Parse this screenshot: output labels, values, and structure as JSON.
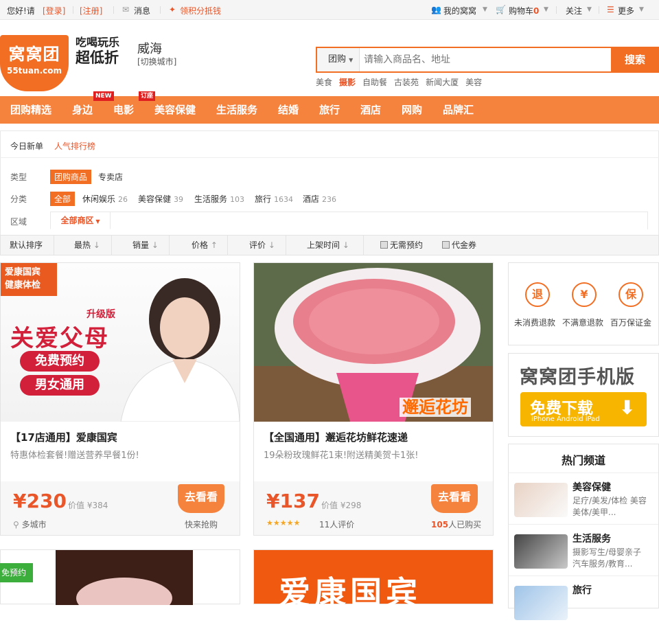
{
  "topbar": {
    "greeting": "您好!请",
    "login": "[登录]",
    "register": "[注册]",
    "messages": "消息",
    "points": "领积分抵钱",
    "my_account": "我的窝窝",
    "cart": "购物车",
    "cart_count": "0",
    "follow": "关注",
    "more": "更多"
  },
  "header": {
    "logo_main": "窝窝团",
    "logo_url": "55tuan.com",
    "slogan_line1": "吃喝玩乐",
    "slogan_line2": "超低折",
    "city": "威海",
    "city_switch": "[切换城市]",
    "search_type": "团购",
    "search_placeholder": "请输入商品名、地址",
    "search_button": "搜索",
    "hot_words": [
      "美食",
      "摄影",
      "自助餐",
      "古装苑",
      "新闻大厦",
      "美容"
    ]
  },
  "nav": {
    "items": [
      "团购精选",
      "身边",
      "电影",
      "美容保健",
      "生活服务",
      "结婚",
      "旅行",
      "酒店",
      "网购",
      "品牌汇"
    ],
    "tag_new": "NEW",
    "tag_order": "订座"
  },
  "tabs": {
    "new_today": "今日新单",
    "ranking": "人气排行榜"
  },
  "filters": {
    "type_label": "类型",
    "type_options": [
      "团购商品",
      "专卖店"
    ],
    "category_label": "分类",
    "category_all": "全部",
    "categories": [
      {
        "name": "休闲娱乐",
        "count": "26"
      },
      {
        "name": "美容保健",
        "count": "39"
      },
      {
        "name": "生活服务",
        "count": "103"
      },
      {
        "name": "旅行",
        "count": "1634"
      },
      {
        "name": "酒店",
        "count": "236"
      }
    ],
    "area_label": "区域",
    "area_all": "全部商区"
  },
  "sort": {
    "default": "默认排序",
    "hot": "最热",
    "sales": "销量",
    "price": "价格",
    "rating": "评价",
    "time": "上架时间",
    "no_reservation": "无需预约",
    "voucher": "代金券"
  },
  "deals": [
    {
      "img_badge_1": "爱康国宾",
      "img_badge_2": "健康体检",
      "img_tag": "升级版",
      "img_headline": "关爱父母",
      "img_pill1": "免费预约",
      "img_pill2": "男女通用",
      "title": "【17店通用】爱康国宾",
      "subtitle": "特惠体检套餐!赠送营养早餐1份!",
      "price": "¥230",
      "original": "价值 ¥384",
      "button": "去看看",
      "location": "多城市",
      "status": "快来抢购"
    },
    {
      "img_caption": "邂逅花坊",
      "title": "【全国通用】邂逅花坊鲜花速递",
      "subtitle": "19朵粉玫瑰鲜花1束!附送精美贺卡1张!",
      "price": "¥137",
      "original": "价值 ¥298",
      "button": "去看看",
      "stars": "★★★★★",
      "reviews": "11人评价",
      "bought_count": "105",
      "bought_label": "人已购买"
    }
  ],
  "bottom_row": {
    "badge": "免预约",
    "brand_text": "爱康国宾"
  },
  "guarantee": {
    "items": [
      {
        "icon": "退",
        "label": "未消费退款"
      },
      {
        "icon": "¥",
        "label": "不满意退款"
      },
      {
        "icon": "保",
        "label": "百万保证金"
      }
    ]
  },
  "mobile": {
    "title": "窝窝团手机版",
    "button": "免费下载",
    "platforms": "iPhone Android iPad"
  },
  "hot_channels": {
    "title": "热门频道",
    "items": [
      {
        "name": "美容保健",
        "desc": "足疗/美发/体检 美容美体/美甲..."
      },
      {
        "name": "生活服务",
        "desc": "摄影写生/母婴亲子 汽车服务/教育..."
      },
      {
        "name": "旅行",
        "desc": ""
      }
    ]
  },
  "colors": {
    "brand": "#f26e23",
    "nav": "#f5823d",
    "price": "#e8562a"
  }
}
